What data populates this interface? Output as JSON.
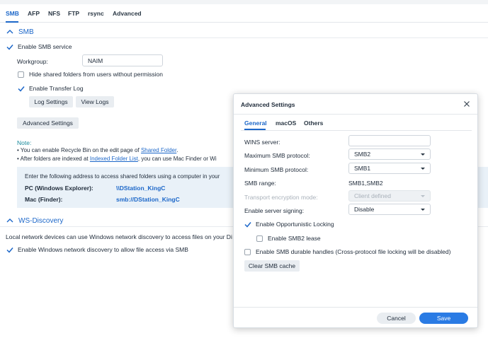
{
  "tabs": [
    {
      "label": "SMB",
      "active": true
    },
    {
      "label": "AFP",
      "active": false
    },
    {
      "label": "NFS",
      "active": false
    },
    {
      "label": "FTP",
      "active": false
    },
    {
      "label": "rsync",
      "active": false
    },
    {
      "label": "Advanced",
      "active": false
    }
  ],
  "smb": {
    "section_title": "SMB",
    "enable_service": {
      "label": "Enable SMB service",
      "checked": true
    },
    "workgroup": {
      "label": "Workgroup:",
      "value": "NAIM"
    },
    "hide_shared": {
      "label": "Hide shared folders from users without permission",
      "checked": false
    },
    "transfer_log": {
      "label": "Enable Transfer Log",
      "checked": true
    },
    "log_settings_label": "Log Settings",
    "view_logs_label": "View Logs",
    "advanced_settings_label": "Advanced Settings",
    "note": {
      "title": "Note:",
      "b1_prefix": "• You can enable Recycle Bin on the edit page of ",
      "b1_link": "Shared Folder",
      "b1_suffix": ".",
      "b2_prefix": "• After folders are indexed at ",
      "b2_link": "Indexed Folder List",
      "b2_suffix": ", you can use Mac Finder or Wi"
    },
    "address_box": {
      "intro": "Enter the following address to access shared folders using a computer in your",
      "pc_label": "PC (Windows Explorer):",
      "pc_value": "\\\\DStation_KingC",
      "mac_label": "Mac (Finder):",
      "mac_value": "smb://DStation_KingC"
    }
  },
  "ws_discovery": {
    "section_title": "WS-Discovery",
    "description": "Local network devices can use Windows network discovery to access files on your Di",
    "enable": {
      "label": "Enable Windows network discovery to allow file access via SMB",
      "checked": true
    }
  },
  "modal": {
    "title": "Advanced Settings",
    "tabs": [
      {
        "label": "General",
        "active": true
      },
      {
        "label": "macOS",
        "active": false
      },
      {
        "label": "Others",
        "active": false
      }
    ],
    "wins_server": {
      "label": "WINS server:",
      "value": ""
    },
    "max_protocol": {
      "label": "Maximum SMB protocol:",
      "value": "SMB2"
    },
    "min_protocol": {
      "label": "Minimum SMB protocol:",
      "value": "SMB1"
    },
    "smb_range": {
      "label": "SMB range:",
      "value": "SMB1,SMB2"
    },
    "transport_encryption": {
      "label": "Transport encryption mode:",
      "value": "Client defined",
      "disabled": true
    },
    "server_signing": {
      "label": "Enable server signing:",
      "value": "Disable"
    },
    "oplock": {
      "label": "Enable Opportunistic Locking",
      "checked": true
    },
    "smb2_lease": {
      "label": "Enable SMB2 lease",
      "checked": false
    },
    "durable_handles": {
      "label": "Enable SMB durable handles (Cross-protocol file locking will be disabled)",
      "checked": false
    },
    "clear_cache_label": "Clear SMB cache",
    "cancel_label": "Cancel",
    "save_label": "Save"
  },
  "colors": {
    "accent": "#1c67c9",
    "save_button": "#2a7be4",
    "note_title": "#1a8a9c",
    "info_box_bg": "#e9f1f8"
  },
  "icons": {
    "section_collapse": "chevron-up-icon",
    "checked": "checkmark-icon",
    "close": "close-icon",
    "select_caret": "caret-down-icon"
  }
}
